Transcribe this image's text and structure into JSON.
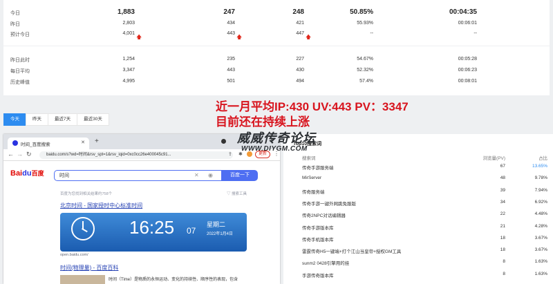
{
  "stats": {
    "rows": [
      {
        "label": "今日",
        "v1": "1,883",
        "v2": "247",
        "v3": "248",
        "v4": "50.85%",
        "v5": "00:04:35",
        "bold": true
      },
      {
        "label": "昨日",
        "v1": "2,803",
        "v2": "434",
        "v3": "421",
        "v4": "55.93%",
        "v5": "00:06:01"
      },
      {
        "label": "预计今日",
        "v1": "4,001",
        "v2": "443",
        "v3": "447",
        "v4": "--",
        "v5": "--",
        "arrows": true
      },
      {
        "label": "昨日此时",
        "v1": "1,254",
        "v2": "235",
        "v3": "227",
        "v4": "54.67%",
        "v5": "00:05:28"
      },
      {
        "label": "每日平均",
        "v1": "3,347",
        "v2": "443",
        "v3": "430",
        "v4": "52.32%",
        "v5": "00:06:23"
      },
      {
        "label": "历史峰值",
        "v1": "4,995",
        "v2": "501",
        "v3": "494",
        "v4": "57.4%",
        "v5": "00:08:01"
      }
    ]
  },
  "tabs": [
    "今天",
    "昨天",
    "最近7天",
    "最近30天"
  ],
  "overlay": {
    "line1": "近一月平均IP:430  UV:443  PV：3347",
    "line2": "目前还在持续上涨",
    "watermark1": "威威传奇论坛",
    "watermark2": "WWW.DIYGM.COM"
  },
  "browser": {
    "tab_title": "时间_百度搜索",
    "url": "baidu.com/s?wd=时间&rsv_spt=1&rsv_iqid=0xc0cc26e400045c91...",
    "update_label": "更新",
    "logo_text": "Bai",
    "logo_paw": "du",
    "logo_cn": "百度",
    "search_value": "时间",
    "search_button": "百度一下",
    "result_count": "百度为您找到相关结果约758个",
    "search_tools": "搜索工具",
    "result1_title": "北京时间 - 国家授时中心标准时间",
    "clock_time": "16:25",
    "clock_sec": "07",
    "clock_weekday": "星期二",
    "clock_date": "2022年1月4日",
    "result1_source": "open.baidu.com/",
    "result2_title": "时间(物理量) - 百度百科",
    "result2_snippet": "时间（Time）是物质的永恒运动、变化的持续性、顺序性的表现，包含"
  },
  "top10": {
    "title": "Top10搜索词",
    "headers": {
      "keyword": "搜索词",
      "pv": "浏览量(PV)",
      "pct": "占比"
    },
    "rows": [
      {
        "kw": "传奇手游服务端",
        "pv": "67",
        "pct": "13.65%",
        "hi": true
      },
      {
        "kw": "MirServer",
        "pv": "48",
        "pct": "9.78%"
      },
      {
        "kw": "传奇服务端",
        "pv": "39",
        "pct": "7.94%"
      },
      {
        "kw": "传奇手游一键外网跳免服版",
        "pv": "34",
        "pct": "6.92%"
      },
      {
        "kw": "传奇2NPC对话编辑器",
        "pv": "22",
        "pct": "4.48%"
      },
      {
        "kw": "传奇手游版本库",
        "pv": "21",
        "pct": "4.28%"
      },
      {
        "kw": "传奇手机版本库",
        "pv": "18",
        "pct": "3.67%"
      },
      {
        "kw": "雷霆传奇H5一键端+打个江山当皇帝+授权GM工具",
        "pv": "18",
        "pct": "3.67%"
      },
      {
        "kw": "sunm2 0428引擎用的挂",
        "pv": "8",
        "pct": "1.63%"
      },
      {
        "kw": "手游传奇版本库",
        "pv": "8",
        "pct": "1.63%"
      }
    ]
  },
  "colors": {
    "accent": "#2d8cf0",
    "overlay_red": "#d8141e",
    "baidu_blue": "#4e6ef2",
    "arrow_red": "#e0271b"
  }
}
